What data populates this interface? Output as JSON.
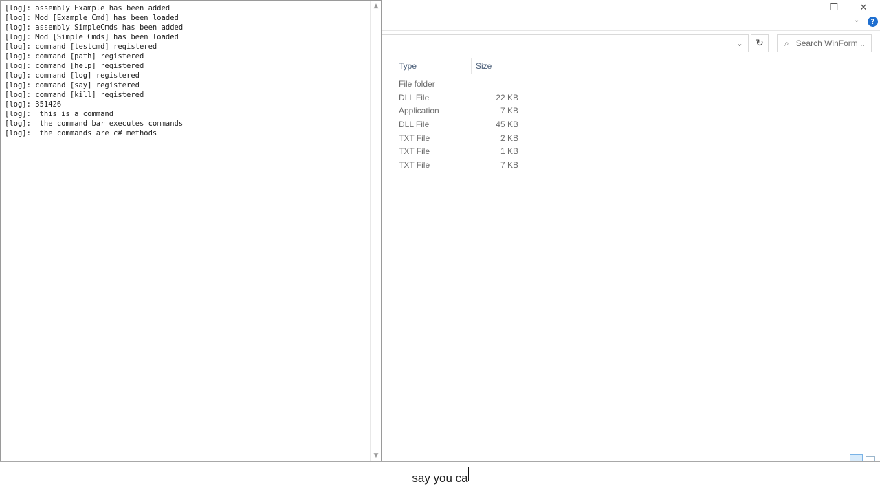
{
  "explorer": {
    "window_controls": {
      "minimize": "—",
      "restore": "❐",
      "close": "✕"
    },
    "help_label": "?",
    "search": {
      "placeholder": "Search WinForm ..."
    },
    "columns": {
      "type": "Type",
      "size": "Size"
    },
    "files": [
      {
        "type": "File folder",
        "size": ""
      },
      {
        "type": "DLL File",
        "size": "22 KB"
      },
      {
        "type": "Application",
        "size": "7 KB"
      },
      {
        "type": "DLL File",
        "size": "45 KB"
      },
      {
        "type": "TXT File",
        "size": "2 KB"
      },
      {
        "type": "TXT File",
        "size": "1 KB"
      },
      {
        "type": "TXT File",
        "size": "7 KB"
      }
    ]
  },
  "console": {
    "lines": [
      "[log]: assembly Example has been added",
      "[log]: Mod [Example Cmd] has been loaded",
      "[log]: assembly SimpleCmds has been added",
      "[log]: Mod [Simple Cmds] has been loaded",
      "[log]: command [testcmd] registered",
      "[log]: command [path] registered",
      "[log]: command [help] registered",
      "[log]: command [log] registered",
      "[log]: command [say] registered",
      "[log]: command [kill] registered",
      "[log]: 351426",
      "[log]:  this is a command",
      "[log]:  the command bar executes commands",
      "[log]:  the commands are c# methods"
    ]
  },
  "command_bar": {
    "value": "say you ca"
  },
  "icons": {
    "search": "⌕",
    "refresh": "↻",
    "dropdown": "⌄",
    "chevron": "⌄",
    "scroll_up": "▲",
    "scroll_down": "▼"
  }
}
